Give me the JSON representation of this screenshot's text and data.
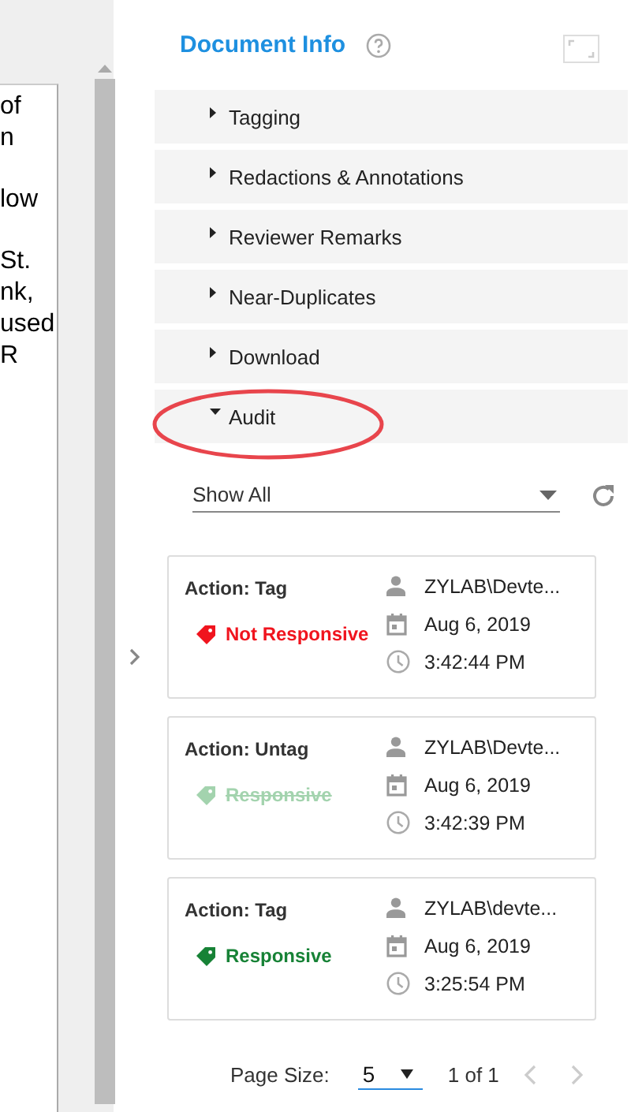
{
  "document_preview": {
    "paragraphs": [
      [
        "of",
        "n"
      ],
      [
        "low"
      ],
      [
        "St.",
        "nk,",
        "used",
        "R"
      ]
    ]
  },
  "panel": {
    "title": "Document Info"
  },
  "sections": [
    {
      "label": "Tagging",
      "expanded": false
    },
    {
      "label": "Redactions & Annotations",
      "expanded": false
    },
    {
      "label": "Reviewer Remarks",
      "expanded": false
    },
    {
      "label": "Near-Duplicates",
      "expanded": false
    },
    {
      "label": "Download",
      "expanded": false
    },
    {
      "label": "Audit",
      "expanded": true,
      "highlighted": true
    }
  ],
  "filter": {
    "value": "Show All"
  },
  "audit_entries": [
    {
      "action": "Action: Tag",
      "kind": "tag",
      "tag": "Not Responsive",
      "color": "#f0141e",
      "user": "ZYLAB\\Devte...",
      "date": "Aug 6, 2019",
      "time": "3:42:44 PM"
    },
    {
      "action": "Action: Untag",
      "kind": "untag",
      "tag": "Responsive",
      "color": "#a3d3ae",
      "user": "ZYLAB\\Devte...",
      "date": "Aug 6, 2019",
      "time": "3:42:39 PM"
    },
    {
      "action": "Action: Tag",
      "kind": "tag",
      "tag": "Responsive",
      "color": "#178236",
      "user": "ZYLAB\\devte...",
      "date": "Aug 6, 2019",
      "time": "3:25:54 PM"
    }
  ],
  "pagination": {
    "label": "Page Size:",
    "page_size": "5",
    "range": "1 of 1"
  }
}
